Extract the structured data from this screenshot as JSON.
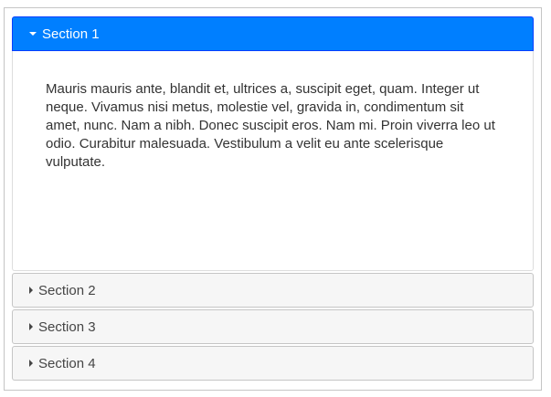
{
  "accordion": {
    "sections": [
      {
        "label": "Section 1",
        "expanded": true,
        "content": "Mauris mauris ante, blandit et, ultrices a, suscipit eget, quam. Integer ut neque. Vivamus nisi metus, molestie vel, gravida in, condimentum sit amet, nunc. Nam a nibh. Donec suscipit eros. Nam mi. Proin viverra leo ut odio. Curabitur malesuada. Vestibulum a velit eu ante scelerisque vulputate."
      },
      {
        "label": "Section 2",
        "expanded": false
      },
      {
        "label": "Section 3",
        "expanded": false
      },
      {
        "label": "Section 4",
        "expanded": false
      }
    ]
  },
  "colors": {
    "active_header": "#007fff",
    "inactive_header": "#f6f6f6",
    "border": "#c5c5c5",
    "text": "#333333"
  },
  "icons": {
    "expanded": "caret-down-icon",
    "collapsed": "caret-right-icon"
  }
}
